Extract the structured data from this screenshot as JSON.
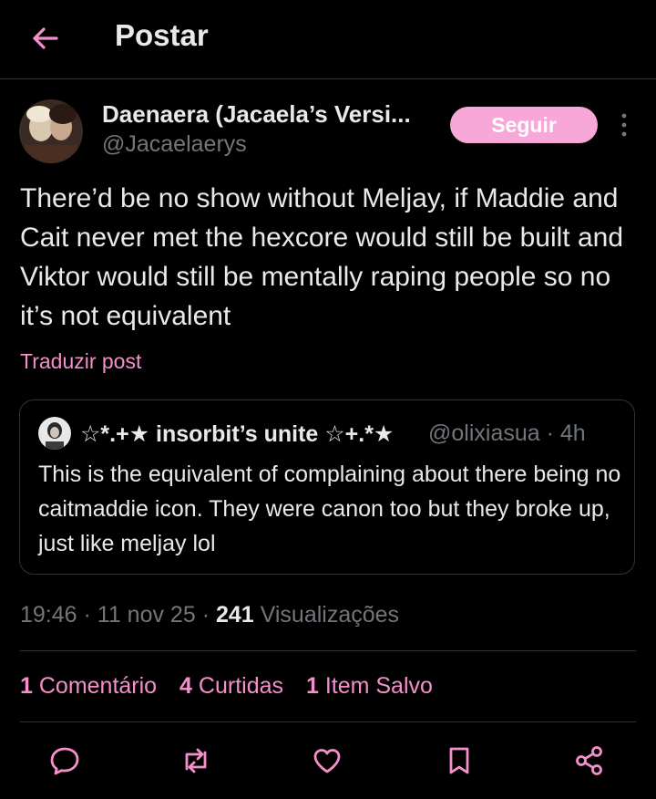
{
  "header": {
    "title": "Postar"
  },
  "post": {
    "author_name": "Daenaera (Jacaela’s Versi...",
    "author_handle": "@Jacaelaerys",
    "follow_label": "Seguir",
    "text": "There’d be no show without Meljay, if Maddie and Cait never met the hexcore would still be built and Viktor would still be mentally raping people so no it’s not equivalent",
    "translate_label": "Traduzir post",
    "time": "19:46",
    "date": "11 nov 25",
    "views_count": "241",
    "views_label": "Visualizações"
  },
  "quote": {
    "author_name": "☆*.+★ insorbit’s unite ☆+.*★",
    "author_handle": "@olixiasua",
    "age": "4h",
    "text": "This is the equivalent of complaining about there being no caitmaddie icon. They were canon too but they broke up, just like meljay lol"
  },
  "stats": {
    "comments_count": "1",
    "comments_label": "Comentário",
    "likes_count": "4",
    "likes_label": "Curtidas",
    "saves_count": "1",
    "saves_label": "Item Salvo"
  },
  "colors": {
    "accent": "#f48fc9",
    "follow_bg": "#f7a8d8",
    "background": "#000000",
    "muted": "#71767b"
  },
  "icons": {
    "back": "arrow-left-icon",
    "more": "more-vertical-icon",
    "reply": "comment-icon",
    "repost": "repost-icon",
    "like": "heart-icon",
    "bookmark": "bookmark-icon",
    "share": "share-icon"
  }
}
